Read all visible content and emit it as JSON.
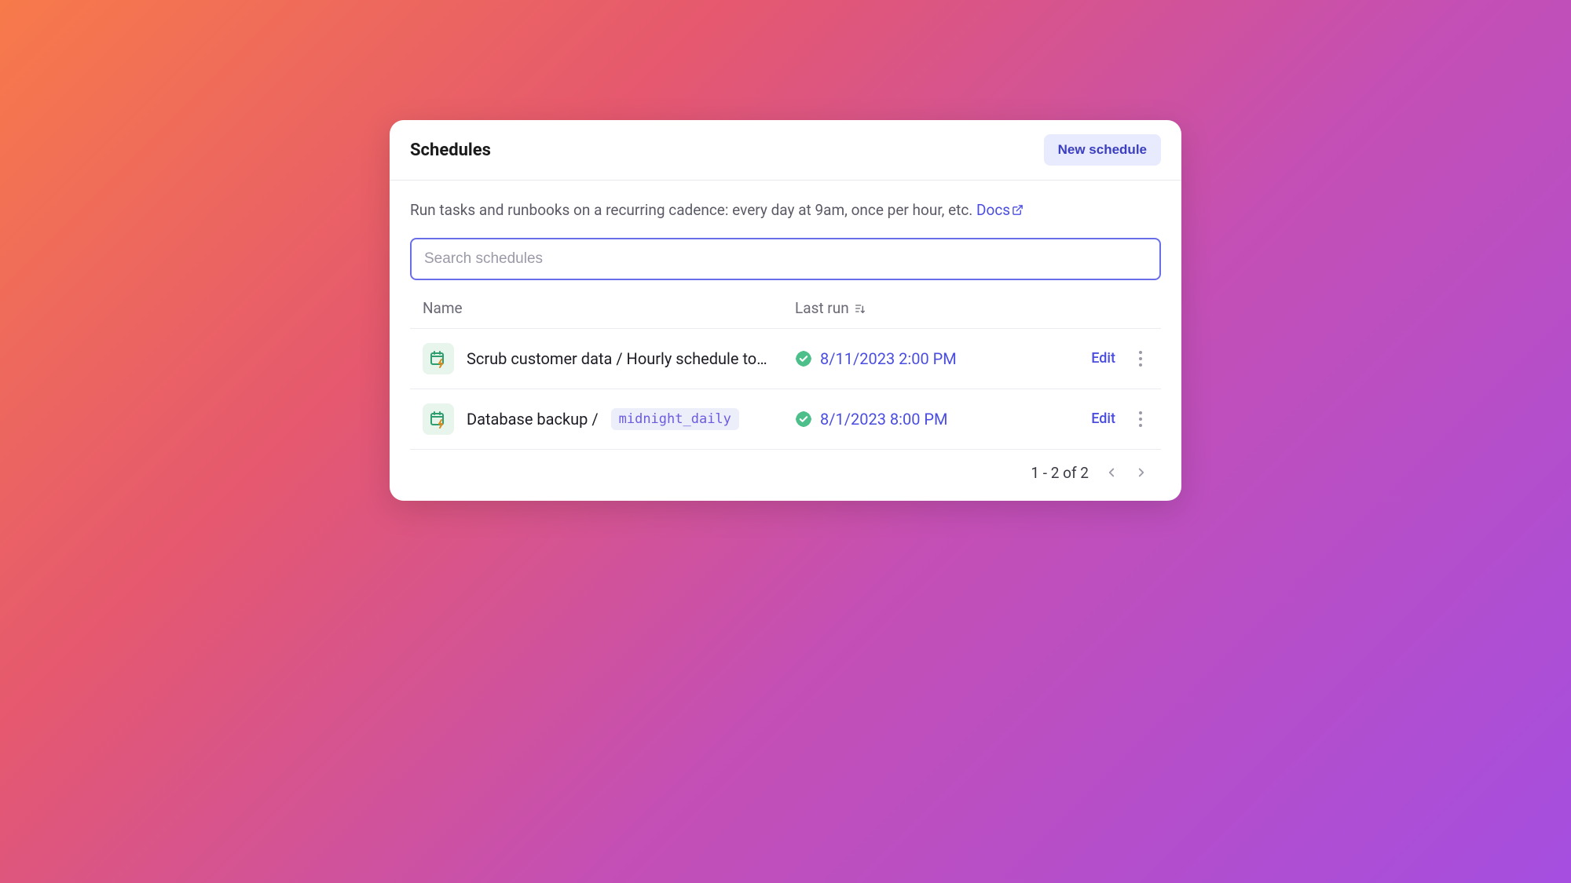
{
  "header": {
    "title": "Schedules",
    "new_button": "New schedule"
  },
  "description": {
    "text": "Run tasks and runbooks on a recurring cadence: every day at 9am, once per hour, etc.",
    "docs_label": "Docs"
  },
  "search": {
    "placeholder": "Search schedules",
    "value": ""
  },
  "columns": {
    "name": "Name",
    "last_run": "Last run"
  },
  "rows": [
    {
      "name": "Scrub customer data / Hourly schedule to…",
      "tag": null,
      "last_run": "8/11/2023 2:00 PM",
      "status": "success",
      "edit_label": "Edit"
    },
    {
      "name": "Database backup /",
      "tag": "midnight_daily",
      "last_run": "8/1/2023 8:00 PM",
      "status": "success",
      "edit_label": "Edit"
    }
  ],
  "pagination": {
    "label": "1 - 2 of 2"
  }
}
